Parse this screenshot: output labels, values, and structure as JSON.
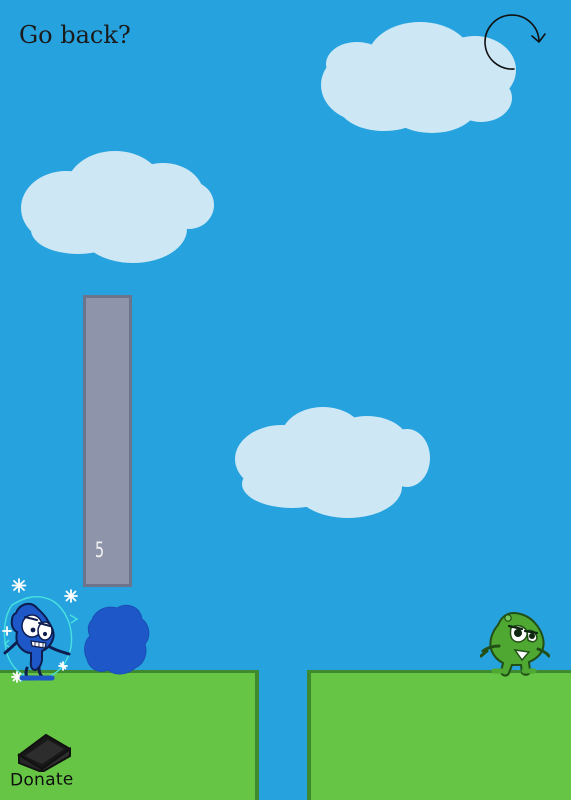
{
  "header": {
    "go_back_label": "Go back?"
  },
  "meter": {
    "value": "5"
  },
  "donate": {
    "label": "Donate"
  },
  "theme": {
    "sky": "#26a3df",
    "cloud": "#cde7f5",
    "ground": "#66c544",
    "ground_edge": "#3f8a2f",
    "meter": "#8e95aa",
    "player": "#1d57c8",
    "enemy": "#4ea832"
  },
  "icons": {
    "restart": "restart-icon",
    "donate": "donate-icon"
  }
}
